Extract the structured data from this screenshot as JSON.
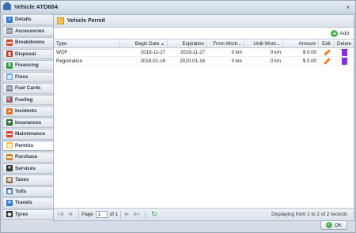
{
  "window": {
    "title": "Vehicle ATD684",
    "close_label": "×"
  },
  "sidebar": {
    "items": [
      {
        "label": "Details",
        "icon": "info-icon",
        "color": "#2f7fd1",
        "glyph": "i"
      },
      {
        "label": "Accessories",
        "icon": "accessories-icon",
        "color": "#8b8f96",
        "glyph": "▭"
      },
      {
        "label": "Breakdowns",
        "icon": "breakdown-icon",
        "color": "#d2452f",
        "glyph": "▬"
      },
      {
        "label": "Disposal",
        "icon": "disposal-icon",
        "color": "#c0392b",
        "glyph": "▮"
      },
      {
        "label": "Financing",
        "icon": "dollar-icon",
        "color": "#2e9b3e",
        "glyph": "$"
      },
      {
        "label": "Fines",
        "icon": "fines-icon",
        "color": "#6aa6e0",
        "glyph": "▤"
      },
      {
        "label": "Fuel Cards",
        "icon": "fuel-card-icon",
        "color": "#7d8ea3",
        "glyph": "▭"
      },
      {
        "label": "Fueling",
        "icon": "fuel-pump-icon",
        "color": "#6b7a8c",
        "glyph": "⛽"
      },
      {
        "label": "Incidents",
        "icon": "cone-icon",
        "color": "#e4742a",
        "glyph": "▲"
      },
      {
        "label": "Insurances",
        "icon": "umbrella-icon",
        "color": "#2f6e3b",
        "glyph": "☂"
      },
      {
        "label": "Maintenance",
        "icon": "maintenance-icon",
        "color": "#d2452f",
        "glyph": "▬"
      },
      {
        "label": "Permits",
        "icon": "permit-icon",
        "color": "#f2c14e",
        "glyph": "▤"
      },
      {
        "label": "Purchase",
        "icon": "purchase-icon",
        "color": "#c8872c",
        "glyph": "▬"
      },
      {
        "label": "Services",
        "icon": "funnel-icon",
        "color": "#3a3a3a",
        "glyph": "▼"
      },
      {
        "label": "Taxes",
        "icon": "building-icon",
        "color": "#8a5a2b",
        "glyph": "▥"
      },
      {
        "label": "Tolls",
        "icon": "tolls-icon",
        "color": "#2f6fb0",
        "glyph": "▦"
      },
      {
        "label": "Travels",
        "icon": "plane-icon",
        "color": "#2f7fd1",
        "glyph": "✈"
      },
      {
        "label": "Tyres",
        "icon": "tyre-icon",
        "color": "#2a2a2a",
        "glyph": "◉"
      }
    ],
    "active_index": 11
  },
  "panel": {
    "title": "Vehicle Permit",
    "add_label": "Add"
  },
  "grid": {
    "columns": [
      "Type",
      "Begin Date",
      "Expiration",
      "From Work...",
      "Until Work...",
      "Amount",
      "Edit",
      "Delete"
    ],
    "sort_indicator": "▲",
    "rows": [
      {
        "type": "WOF",
        "begin": "2018-11-27",
        "expiration": "2019-11-27",
        "from": "0 km",
        "until": "0 km",
        "amount": "$ 0.00"
      },
      {
        "type": "Registration",
        "begin": "2019-01-16",
        "expiration": "2020-01-16",
        "from": "0 km",
        "until": "0 km",
        "amount": "$ 0.00"
      }
    ]
  },
  "pager": {
    "page_label": "Page",
    "page_value": "1",
    "of_label": "of 1",
    "display": "Displaying from 1 to 2 of 2 records"
  },
  "footer": {
    "ok_label": "OK"
  }
}
